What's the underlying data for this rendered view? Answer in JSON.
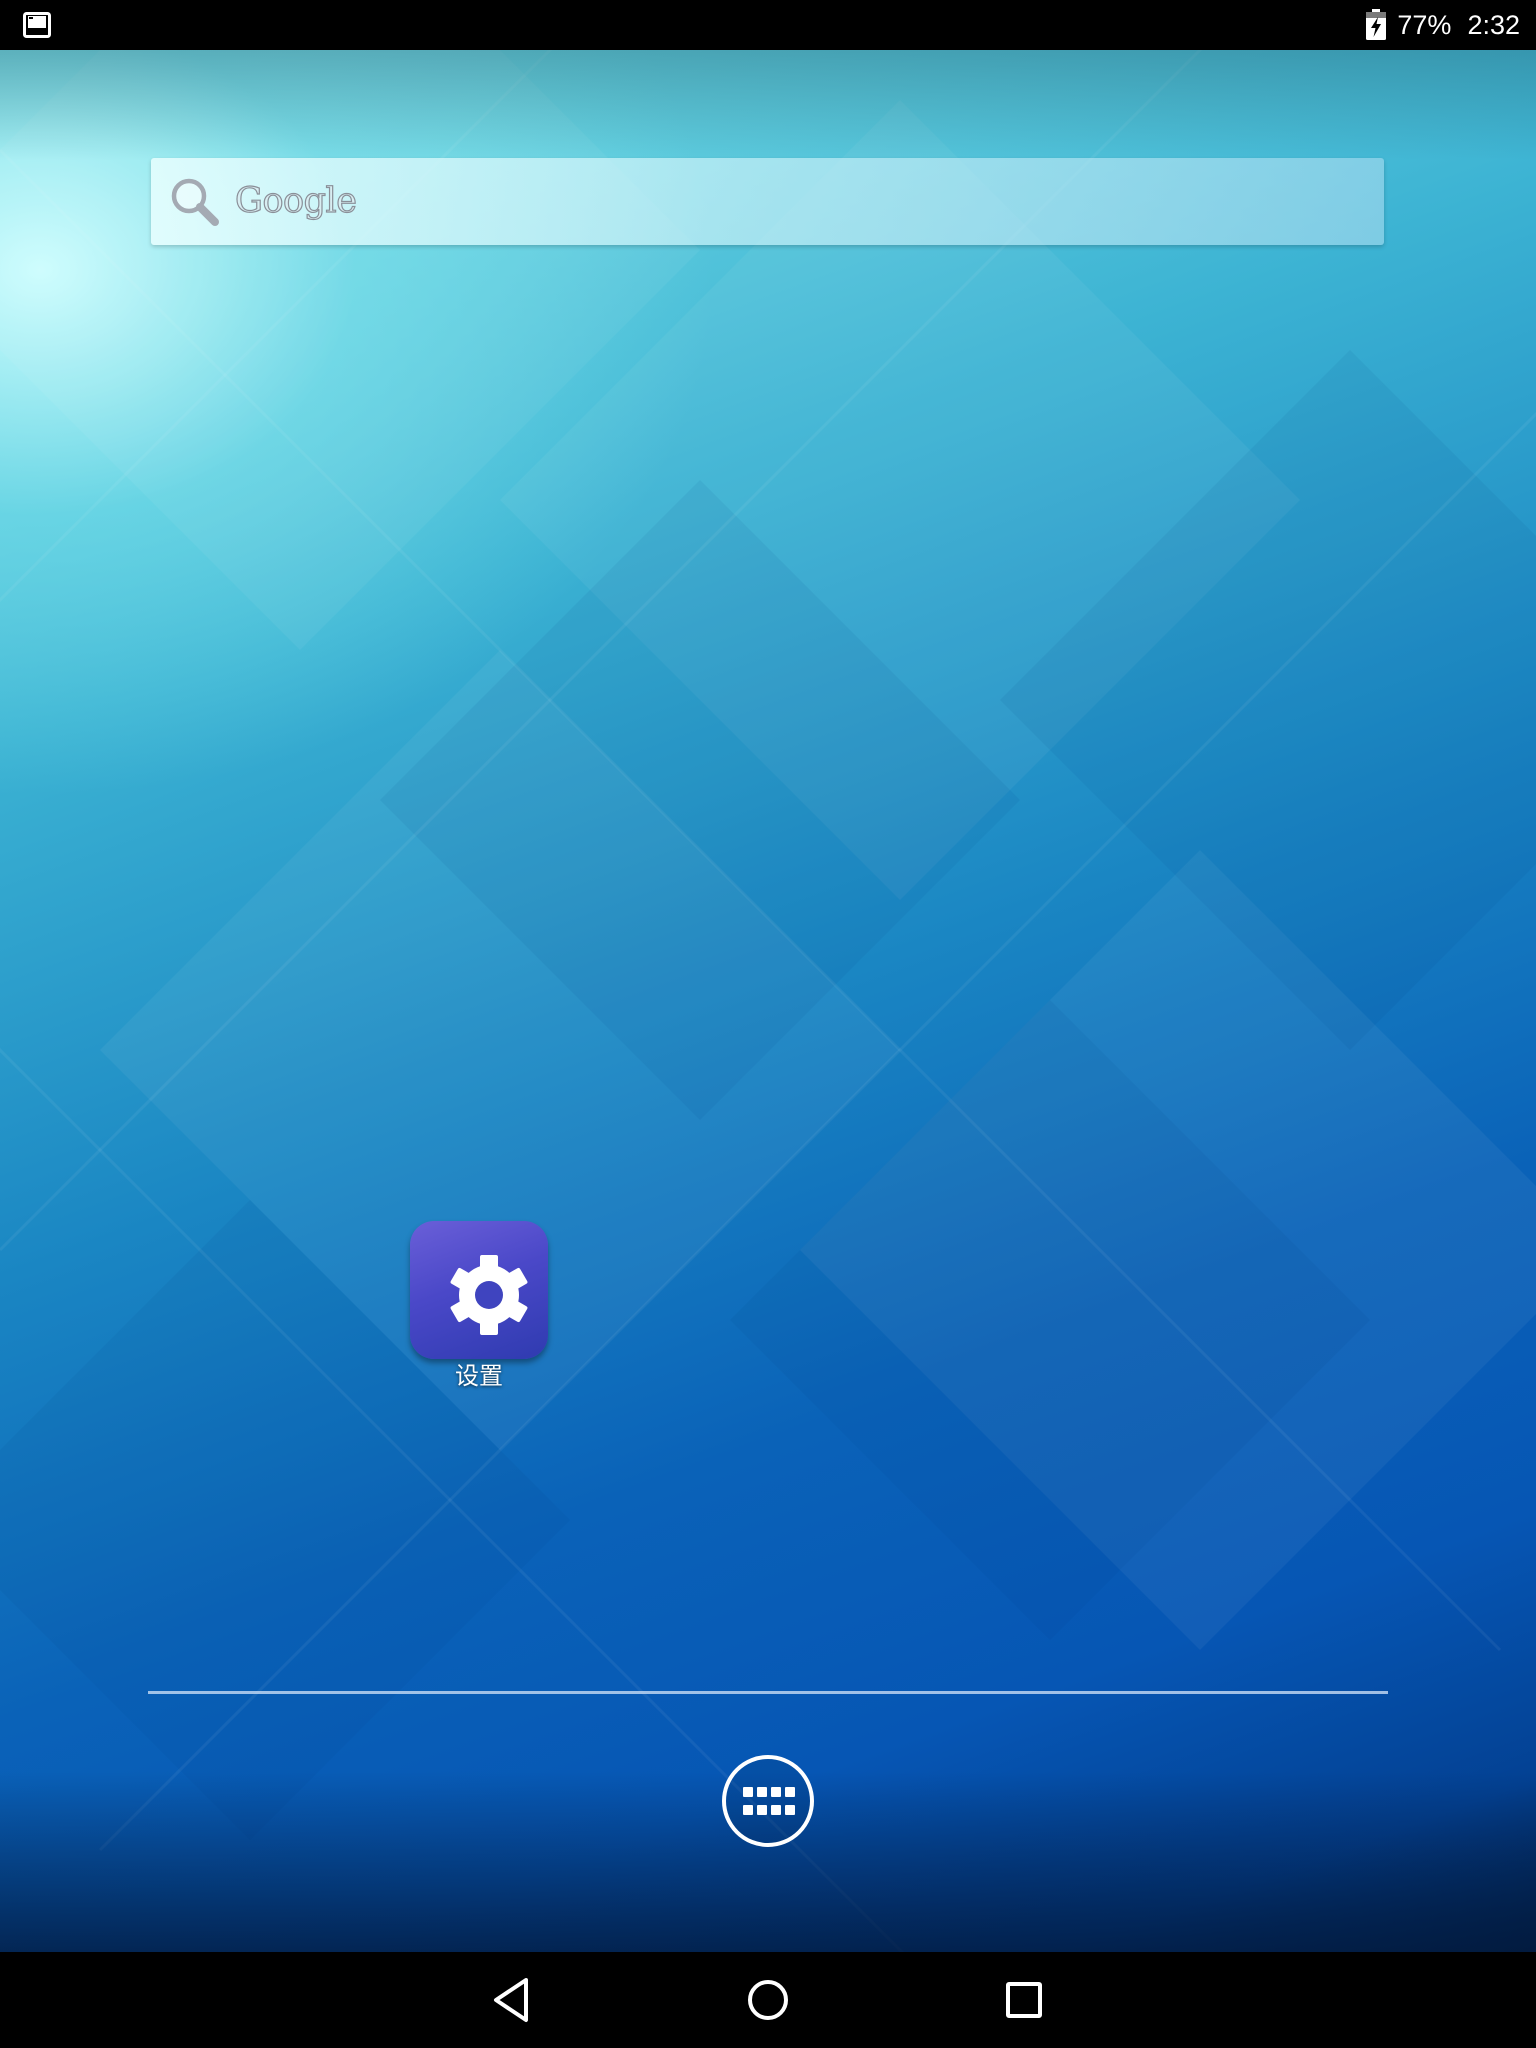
{
  "status_bar": {
    "notification_icon": "screenshot-notification-icon",
    "battery_icon": "battery-charging-icon",
    "battery_percent": "77%",
    "time": "2:32"
  },
  "search_widget": {
    "text": "Google",
    "icon": "search-icon"
  },
  "home_apps": [
    {
      "label": "设置",
      "icon": "gear-icon",
      "tile_color": "#4a48c8"
    }
  ],
  "dock": {
    "all_apps_icon": "all-apps-icon"
  },
  "nav_bar": {
    "back_icon": "back-icon",
    "home_icon": "home-icon",
    "recents_icon": "recents-icon"
  },
  "colors": {
    "wallpaper_top": "#7ee3e8",
    "wallpaper_bottom": "#0656b4",
    "bars": "#000000"
  }
}
